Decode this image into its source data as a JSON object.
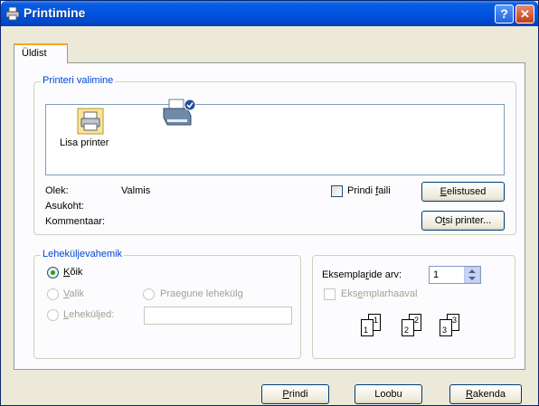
{
  "window": {
    "title": "Printimine",
    "help_symbol": "?",
    "close_symbol": "✕"
  },
  "tabs": [
    {
      "label": "Üldist"
    }
  ],
  "printer_selection": {
    "legend": "Printeri valimine",
    "items": [
      {
        "label": "Lisa printer",
        "icon": "add-printer-icon"
      },
      {
        "label": "",
        "icon": "printer-icon"
      }
    ]
  },
  "status": {
    "olek_label": "Olek:",
    "olek_value": "Valmis",
    "asukoht_label": "Asukoht:",
    "kommentaar_label": "Kommentaar:",
    "print_to_file": {
      "pre": "Prindi ",
      "accel": "f",
      "post": "aili",
      "checked": false
    },
    "preferences_button": {
      "pre": "",
      "accel": "E",
      "post": "elistused"
    },
    "find_printer_button": {
      "pre": "O",
      "accel": "t",
      "post": "si printer..."
    }
  },
  "page_range": {
    "legend": "Leheküljevahemik",
    "all": {
      "accel": "K",
      "post": "õik",
      "selected": true
    },
    "selection": {
      "accel": "V",
      "post": "alik"
    },
    "current_page": {
      "label": "Praegune lehekülg"
    },
    "pages": {
      "accel": "L",
      "post": "eheküljed:",
      "value": ""
    }
  },
  "copies": {
    "count_label": {
      "pre": "Eksempla",
      "accel": "r",
      "post": "ide arv:"
    },
    "count_value": "1",
    "collate": {
      "pre": "Eks",
      "accel": "e",
      "post": "mplarhaaval",
      "checked": false
    },
    "collate_pages": [
      "1",
      "1",
      "2",
      "2",
      "3",
      "3"
    ]
  },
  "buttons": {
    "print": {
      "accel": "P",
      "post": "rindi"
    },
    "cancel": {
      "label": "Loobu"
    },
    "apply": {
      "accel": "R",
      "post": "akenda"
    }
  }
}
